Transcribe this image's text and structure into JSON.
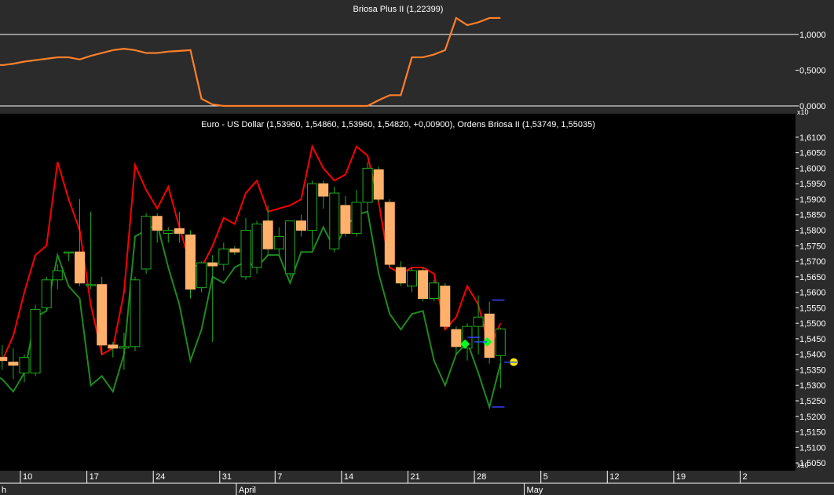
{
  "colors": {
    "top_panel_bg": "#2b2b2b",
    "main_panel_bg": "#000000",
    "axis_bg": "#2b2b2b",
    "briosa_line": "#ff7f2a",
    "upper_band": "#ff0000",
    "lower_band": "#1f8a1f",
    "candle_up": "#000000",
    "candle_up_outline": "#1fae1f",
    "candle_down": "#ffb06a",
    "wick": "#1fae1f",
    "marker_green": "#00ff22",
    "marker_yellow": "#ffee00",
    "marker_blue": "#3344ff",
    "text": "#ffffff"
  },
  "chart_data": [
    {
      "type": "line",
      "title": "Briosa Plus II (1,22399)",
      "x": [
        1,
        2,
        3,
        4,
        5,
        6,
        7,
        8,
        9,
        10,
        11,
        12,
        13,
        14,
        15,
        16,
        17,
        18,
        19,
        20,
        21,
        22,
        23,
        24,
        25,
        26,
        27,
        28,
        29,
        30,
        31,
        32,
        33,
        34,
        35,
        36,
        37,
        38,
        39,
        40,
        41,
        42,
        43,
        44,
        45,
        46,
        47,
        48
      ],
      "values": [
        0.58,
        0.58,
        0.57,
        0.59,
        0.62,
        0.64,
        0.66,
        0.68,
        0.68,
        0.65,
        0.7,
        0.74,
        0.78,
        0.8,
        0.78,
        0.74,
        0.74,
        0.76,
        0.77,
        0.78,
        0.1,
        0.02,
        0.0,
        0.0,
        0.0,
        0.0,
        0.0,
        0.0,
        0.0,
        0.0,
        0.0,
        0.0,
        0.0,
        0.0,
        0.0,
        0.0,
        0.08,
        0.15,
        0.15,
        0.68,
        0.68,
        0.72,
        0.78,
        1.23,
        1.13,
        1.17,
        1.23,
        1.23
      ],
      "y_ticks": [
        "1,0000",
        "0,5000",
        "0,0000"
      ],
      "y_tick_values": [
        1.0,
        0.5,
        0.0
      ],
      "ylim": [
        0.0,
        1.35
      ],
      "horizontal_lines": [
        1.0,
        0.0
      ]
    },
    {
      "type": "candlestick",
      "title": "Euro - US Dollar (1,53960, 1,54860, 1,53960, 1,54820, +0,00900), Ordens Briosa II (1,53749, 1,55035)",
      "y_unit_label": "x10",
      "ylim": [
        1.503,
        1.6125
      ],
      "y_ticks": [
        "1,6100",
        "1,6050",
        "1,6000",
        "1,5950",
        "1,5900",
        "1,5850",
        "1,5800",
        "1,5750",
        "1,5700",
        "1,5650",
        "1,5600",
        "1,5550",
        "1,5500",
        "1,5450",
        "1,5400",
        "1,5350",
        "1,5300",
        "1,5250",
        "1,5200",
        "1,5150",
        "1,5100",
        "1,5050"
      ],
      "y_tick_values": [
        1.61,
        1.605,
        1.6,
        1.595,
        1.59,
        1.585,
        1.58,
        1.575,
        1.57,
        1.565,
        1.56,
        1.555,
        1.55,
        1.545,
        1.54,
        1.535,
        1.53,
        1.525,
        1.52,
        1.515,
        1.51,
        1.505
      ],
      "x_ticks": [
        "10",
        "17",
        "24",
        "31",
        "7",
        "14",
        "21",
        "28",
        "5",
        "12",
        "19",
        "2"
      ],
      "x_tick_values": [
        5,
        11,
        17,
        23,
        28,
        34,
        40,
        46,
        52,
        58,
        64,
        70
      ],
      "month_labels": [
        {
          "label": "h",
          "x": 0.8
        },
        {
          "label": "April",
          "x": 24.5
        },
        {
          "label": "May",
          "x": 50.5
        }
      ],
      "candles": [
        {
          "x": 1,
          "open": 1.5215,
          "high": 1.53,
          "low": 1.517,
          "close": 1.526
        },
        {
          "x": 2,
          "open": 1.5265,
          "high": 1.54,
          "low": 1.525,
          "close": 1.538
        },
        {
          "x": 3,
          "open": 1.539,
          "high": 1.543,
          "low": 1.535,
          "close": 1.538
        },
        {
          "x": 4,
          "open": 1.5375,
          "high": 1.542,
          "low": 1.532,
          "close": 1.5365
        },
        {
          "x": 5,
          "open": 1.534,
          "high": 1.54,
          "low": 1.531,
          "close": 1.539
        },
        {
          "x": 6,
          "open": 1.534,
          "high": 1.556,
          "low": 1.533,
          "close": 1.5545
        },
        {
          "x": 7,
          "open": 1.555,
          "high": 1.565,
          "low": 1.554,
          "close": 1.564
        },
        {
          "x": 8,
          "open": 1.564,
          "high": 1.569,
          "low": 1.561,
          "close": 1.567
        },
        {
          "x": 9,
          "open": 1.573,
          "high": 1.573,
          "low": 1.57,
          "close": 1.573
        },
        {
          "x": 10,
          "open": 1.573,
          "high": 1.59,
          "low": 1.562,
          "close": 1.563
        },
        {
          "x": 11,
          "open": 1.5625,
          "high": 1.586,
          "low": 1.561,
          "close": 1.5625
        },
        {
          "x": 12,
          "open": 1.5625,
          "high": 1.565,
          "low": 1.54,
          "close": 1.543
        },
        {
          "x": 13,
          "open": 1.543,
          "high": 1.544,
          "low": 1.539,
          "close": 1.542
        },
        {
          "x": 14,
          "open": 1.542,
          "high": 1.547,
          "low": 1.535,
          "close": 1.5425
        },
        {
          "x": 15,
          "open": 1.5425,
          "high": 1.565,
          "low": 1.541,
          "close": 1.564
        },
        {
          "x": 16,
          "open": 1.5675,
          "high": 1.5855,
          "low": 1.566,
          "close": 1.5845
        },
        {
          "x": 17,
          "open": 1.5845,
          "high": 1.5855,
          "low": 1.576,
          "close": 1.58
        },
        {
          "x": 18,
          "open": 1.579,
          "high": 1.581,
          "low": 1.576,
          "close": 1.58
        },
        {
          "x": 19,
          "open": 1.5805,
          "high": 1.586,
          "low": 1.576,
          "close": 1.579
        },
        {
          "x": 20,
          "open": 1.5785,
          "high": 1.58,
          "low": 1.558,
          "close": 1.561
        },
        {
          "x": 21,
          "open": 1.5615,
          "high": 1.57,
          "low": 1.56,
          "close": 1.5695
        },
        {
          "x": 22,
          "open": 1.5695,
          "high": 1.572,
          "low": 1.544,
          "close": 1.5685
        },
        {
          "x": 23,
          "open": 1.569,
          "high": 1.576,
          "low": 1.567,
          "close": 1.574
        },
        {
          "x": 24,
          "open": 1.574,
          "high": 1.575,
          "low": 1.572,
          "close": 1.573
        },
        {
          "x": 25,
          "open": 1.565,
          "high": 1.584,
          "low": 1.564,
          "close": 1.58
        },
        {
          "x": 26,
          "open": 1.568,
          "high": 1.583,
          "low": 1.566,
          "close": 1.582
        },
        {
          "x": 27,
          "open": 1.583,
          "high": 1.588,
          "low": 1.572,
          "close": 1.574
        },
        {
          "x": 28,
          "open": 1.574,
          "high": 1.581,
          "low": 1.572,
          "close": 1.578
        },
        {
          "x": 29,
          "open": 1.566,
          "high": 1.583,
          "low": 1.565,
          "close": 1.583
        },
        {
          "x": 30,
          "open": 1.583,
          "high": 1.585,
          "low": 1.578,
          "close": 1.58
        },
        {
          "x": 31,
          "open": 1.58,
          "high": 1.596,
          "low": 1.574,
          "close": 1.595
        },
        {
          "x": 32,
          "open": 1.595,
          "high": 1.596,
          "low": 1.587,
          "close": 1.591
        },
        {
          "x": 33,
          "open": 1.574,
          "high": 1.594,
          "low": 1.573,
          "close": 1.592
        },
        {
          "x": 34,
          "open": 1.588,
          "high": 1.591,
          "low": 1.578,
          "close": 1.579
        },
        {
          "x": 35,
          "open": 1.579,
          "high": 1.593,
          "low": 1.578,
          "close": 1.589
        },
        {
          "x": 36,
          "open": 1.589,
          "high": 1.602,
          "low": 1.586,
          "close": 1.6
        },
        {
          "x": 37,
          "open": 1.5995,
          "high": 1.6005,
          "low": 1.589,
          "close": 1.59
        },
        {
          "x": 38,
          "open": 1.589,
          "high": 1.59,
          "low": 1.568,
          "close": 1.569
        },
        {
          "x": 39,
          "open": 1.568,
          "high": 1.57,
          "low": 1.562,
          "close": 1.563
        },
        {
          "x": 40,
          "open": 1.562,
          "high": 1.568,
          "low": 1.56,
          "close": 1.567
        },
        {
          "x": 41,
          "open": 1.567,
          "high": 1.568,
          "low": 1.557,
          "close": 1.558
        },
        {
          "x": 42,
          "open": 1.558,
          "high": 1.564,
          "low": 1.557,
          "close": 1.563
        },
        {
          "x": 43,
          "open": 1.562,
          "high": 1.563,
          "low": 1.548,
          "close": 1.549
        },
        {
          "x": 44,
          "open": 1.548,
          "high": 1.549,
          "low": 1.54,
          "close": 1.5425
        },
        {
          "x": 45,
          "open": 1.542,
          "high": 1.55,
          "low": 1.538,
          "close": 1.549
        },
        {
          "x": 46,
          "open": 1.549,
          "high": 1.559,
          "low": 1.54,
          "close": 1.552
        },
        {
          "x": 47,
          "open": 1.553,
          "high": 1.557,
          "low": 1.537,
          "close": 1.539
        },
        {
          "x": 48,
          "open": 1.5396,
          "high": 1.5486,
          "low": 1.529,
          "close": 1.5482
        }
      ],
      "upper_band": [
        1.53,
        1.537,
        1.543,
        1.538,
        1.546,
        1.56,
        1.572,
        1.575,
        1.602,
        1.59,
        1.58,
        1.556,
        1.54,
        1.542,
        1.56,
        1.601,
        1.593,
        1.587,
        1.594,
        1.581,
        1.569,
        1.568,
        1.575,
        1.584,
        1.582,
        1.592,
        1.596,
        1.586,
        1.587,
        1.588,
        1.59,
        1.607,
        1.6,
        1.596,
        1.598,
        1.607,
        1.604,
        1.589,
        1.568,
        1.566,
        1.568,
        1.568,
        1.566,
        1.548,
        1.552,
        1.562,
        1.556,
        1.542,
        1.55
      ],
      "lower_band": [
        1.512,
        1.528,
        1.534,
        1.532,
        1.528,
        1.534,
        1.552,
        1.554,
        1.572,
        1.562,
        1.558,
        1.53,
        1.533,
        1.528,
        1.54,
        1.578,
        1.58,
        1.582,
        1.568,
        1.556,
        1.538,
        1.548,
        1.565,
        1.563,
        1.568,
        1.57,
        1.568,
        1.572,
        1.572,
        1.563,
        1.573,
        1.573,
        1.581,
        1.574,
        1.581,
        1.585,
        1.586,
        1.566,
        1.553,
        1.548,
        1.553,
        1.554,
        1.538,
        1.53,
        1.54,
        1.544,
        1.534,
        1.523,
        1.537
      ],
      "markers": [
        {
          "shape": "diamond",
          "color": "marker_green",
          "x": 44.8,
          "y": 1.5433
        },
        {
          "shape": "diamond",
          "color": "marker_green",
          "x": 46.8,
          "y": 1.544
        },
        {
          "shape": "circle",
          "color": "marker_yellow",
          "x": 49.2,
          "y": 1.5375
        },
        {
          "shape": "dash",
          "color": "marker_blue",
          "x": 45.6,
          "y": 1.5455
        },
        {
          "shape": "dash",
          "color": "marker_blue",
          "x": 46.2,
          "y": 1.544
        },
        {
          "shape": "dash",
          "color": "marker_blue",
          "x": 47.8,
          "y": 1.5575
        },
        {
          "shape": "dash",
          "color": "marker_blue",
          "x": 47.8,
          "y": 1.523
        },
        {
          "shape": "dash",
          "color": "marker_blue",
          "x": 48.9,
          "y": 1.5375
        }
      ]
    }
  ]
}
